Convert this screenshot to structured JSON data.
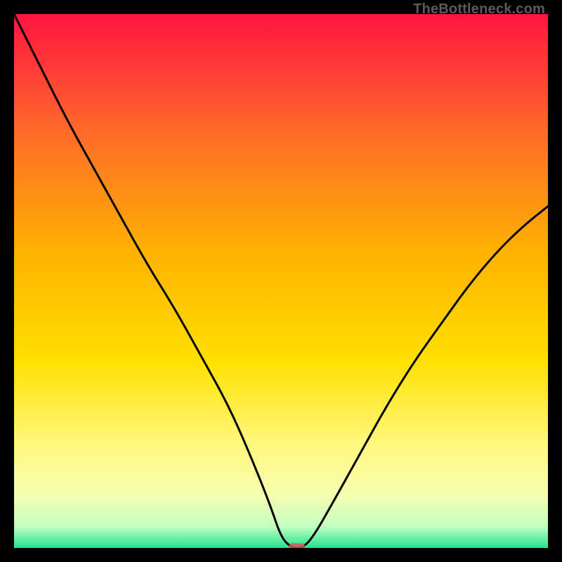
{
  "watermark": "TheBottleneck.com",
  "colors": {
    "top": "#ff1440",
    "mid1": "#ff6a2a",
    "mid2": "#ffb300",
    "mid3": "#ffe000",
    "mid4": "#fff77a",
    "mid5": "#f6ffb0",
    "mid6": "#c3ffc0",
    "bottom": "#22e38f",
    "curve": "#000000",
    "marker": "#cd5c5c",
    "frame": "#000000"
  },
  "chart_data": {
    "type": "line",
    "title": "",
    "xlabel": "",
    "ylabel": "",
    "xlim": [
      0,
      100
    ],
    "ylim": [
      0,
      100
    ],
    "series": [
      {
        "name": "curve",
        "x": [
          0,
          5,
          10,
          15,
          20,
          25,
          30,
          35,
          40,
          44,
          48,
          50,
          52,
          54,
          56,
          60,
          65,
          70,
          75,
          80,
          85,
          90,
          95,
          100
        ],
        "y": [
          100,
          90,
          80,
          71,
          62,
          53,
          45,
          36,
          27,
          18,
          8,
          2,
          0,
          0,
          2,
          9,
          18,
          27,
          35,
          42,
          49,
          55,
          60,
          64
        ]
      }
    ],
    "marker": {
      "x": 53,
      "y": 0,
      "w": 3.2,
      "h": 1.8
    },
    "notes": "Vertical gradient background from red (top) → orange → yellow → pale → green (bottom). Black V-shaped curve with minimum near x≈53 touching y≈0; small rounded rectangle marker at the minimum."
  }
}
